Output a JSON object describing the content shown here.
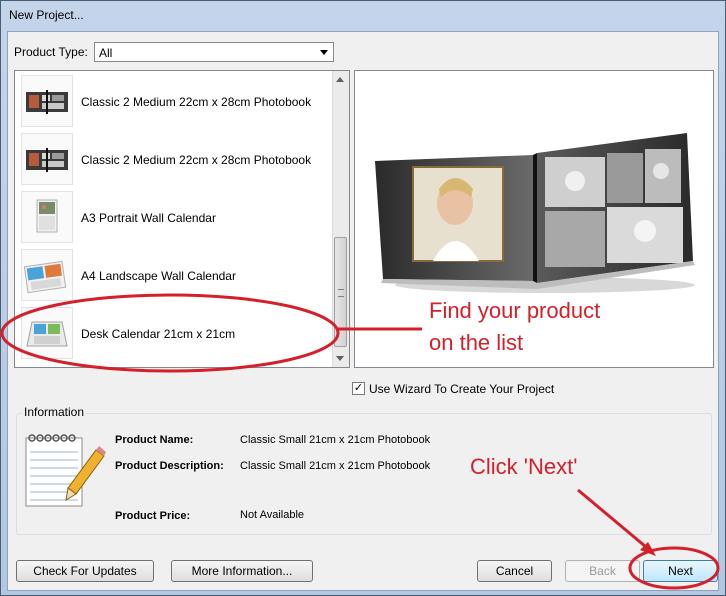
{
  "window": {
    "title": "New Project..."
  },
  "filter": {
    "label": "Product Type:",
    "selected": "All"
  },
  "products": [
    {
      "name": "Classic 2 Medium 22cm x 28cm Photobook",
      "thumb": "photobook"
    },
    {
      "name": "Classic 2 Medium 22cm x 28cm Photobook",
      "thumb": "photobook"
    },
    {
      "name": "A3 Portrait Wall Calendar",
      "thumb": "wall-calendar-portrait"
    },
    {
      "name": "A4 Landscape Wall Calendar",
      "thumb": "wall-calendar-landscape"
    },
    {
      "name": "Desk Calendar 21cm x 21cm",
      "thumb": "desk-calendar"
    }
  ],
  "wizard": {
    "label": "Use Wizard To Create Your Project",
    "checked": true
  },
  "info": {
    "title": "Information",
    "icon": "notepad-pencil-icon",
    "name_label": "Product Name:",
    "name_value": "Classic Small 21cm x 21cm Photobook",
    "desc_label": "Product Description:",
    "desc_value": "Classic Small 21cm x 21cm Photobook",
    "price_label": "Product Price:",
    "price_value": "Not Available"
  },
  "buttons": {
    "updates": "Check For Updates",
    "more": "More Information...",
    "cancel": "Cancel",
    "back": "Back",
    "next": "Next"
  },
  "annotations": {
    "find_line1": "Find your product",
    "find_line2": "on the list",
    "click_next": "Click 'Next'",
    "color": "#d4202a"
  }
}
